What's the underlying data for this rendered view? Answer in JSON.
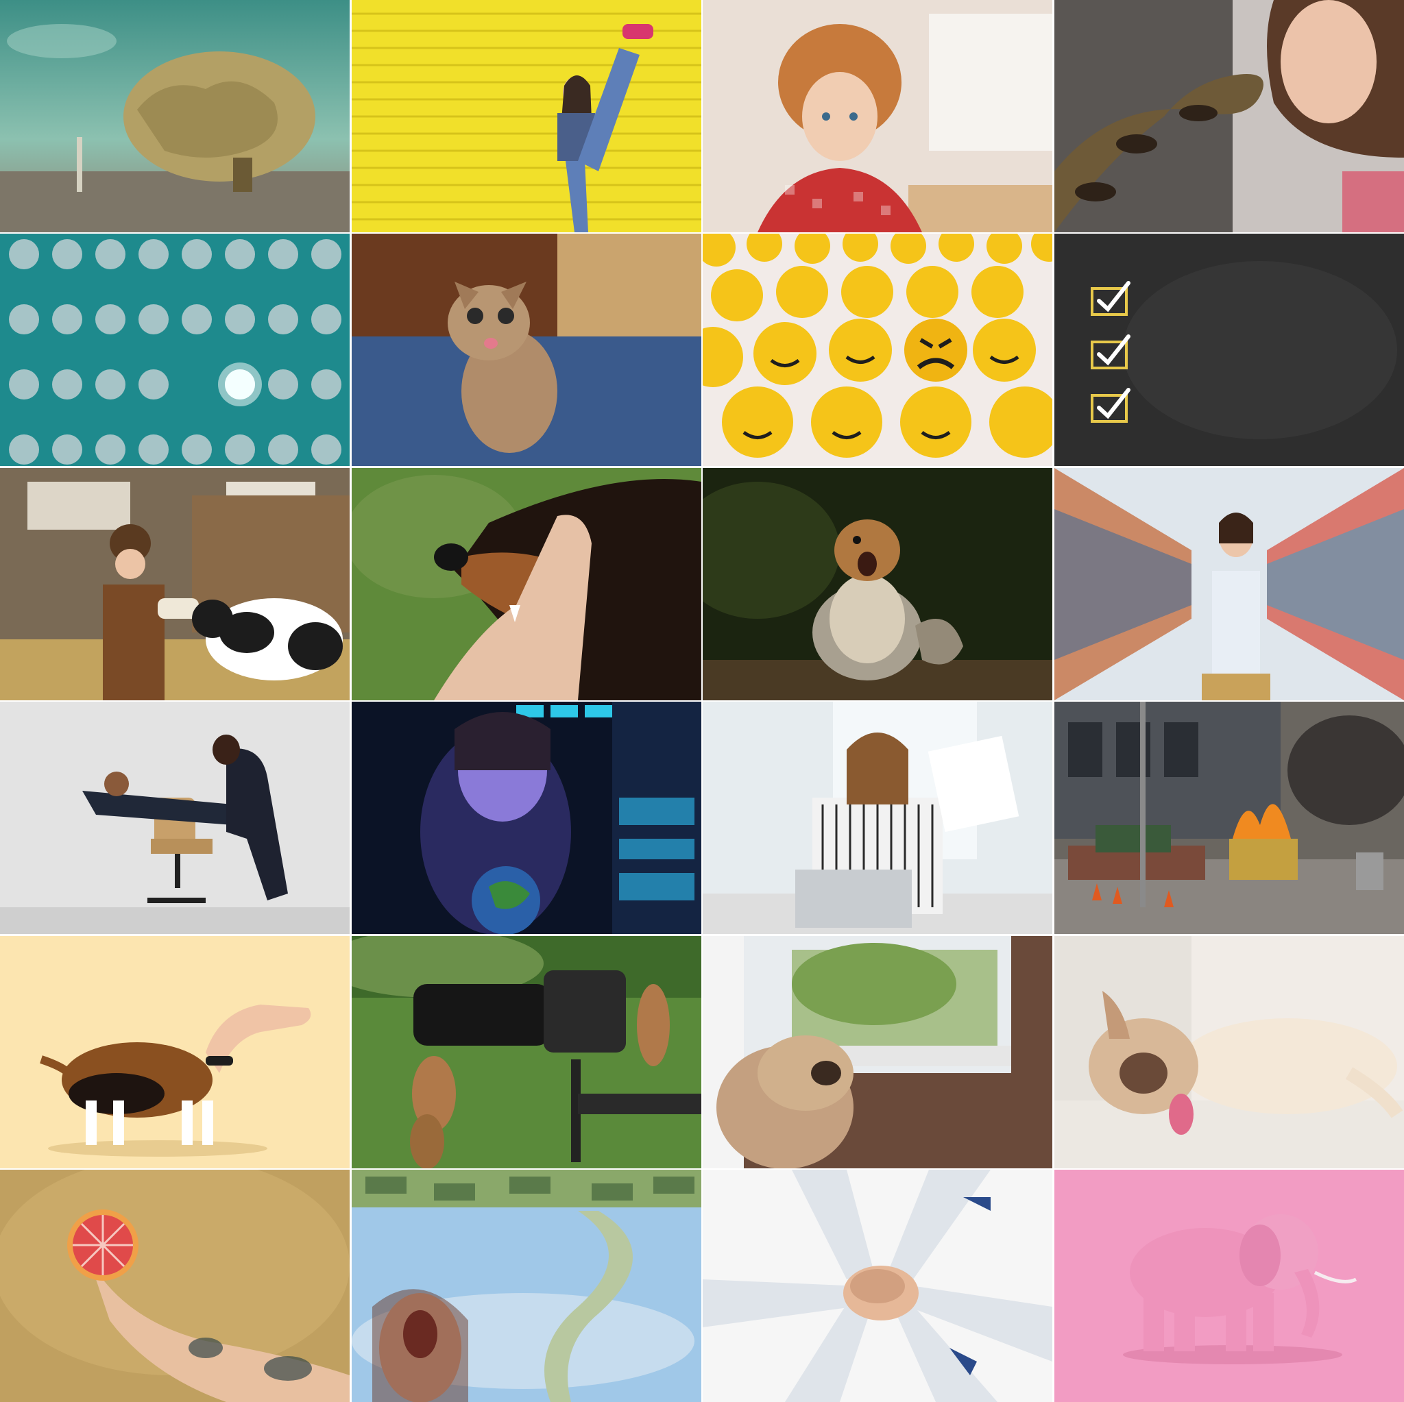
{
  "layout": {
    "columns": 4,
    "rows": 6
  },
  "tiles": [
    {
      "subject": "giant-brain-surreal"
    },
    {
      "subject": "girl-kick-yellow-shutter"
    },
    {
      "subject": "curly-hair-child"
    },
    {
      "subject": "woman-with-python"
    },
    {
      "subject": "lightbulbs-one-lit"
    },
    {
      "subject": "surprised-kitten"
    },
    {
      "subject": "emoji-balls-angry-one"
    },
    {
      "subject": "chalkboard-checkboxes"
    },
    {
      "subject": "child-feeding-calf"
    },
    {
      "subject": "dog-biting-thumb"
    },
    {
      "subject": "shouting-squirrel"
    },
    {
      "subject": "woman-supermarket-rush"
    },
    {
      "subject": "businessmen-chair-push"
    },
    {
      "subject": "woman-data-screens"
    },
    {
      "subject": "meditating-office-woman"
    },
    {
      "subject": "burning-dumpster-street"
    },
    {
      "subject": "beagle-hand-head"
    },
    {
      "subject": "squirrels-on-camera"
    },
    {
      "subject": "pug-at-window"
    },
    {
      "subject": "sleeping-bulldog"
    },
    {
      "subject": "hand-holding-grapefruit"
    },
    {
      "subject": "woman-money-tornado"
    },
    {
      "subject": "team-hands-stack"
    },
    {
      "subject": "pink-elephant"
    }
  ]
}
